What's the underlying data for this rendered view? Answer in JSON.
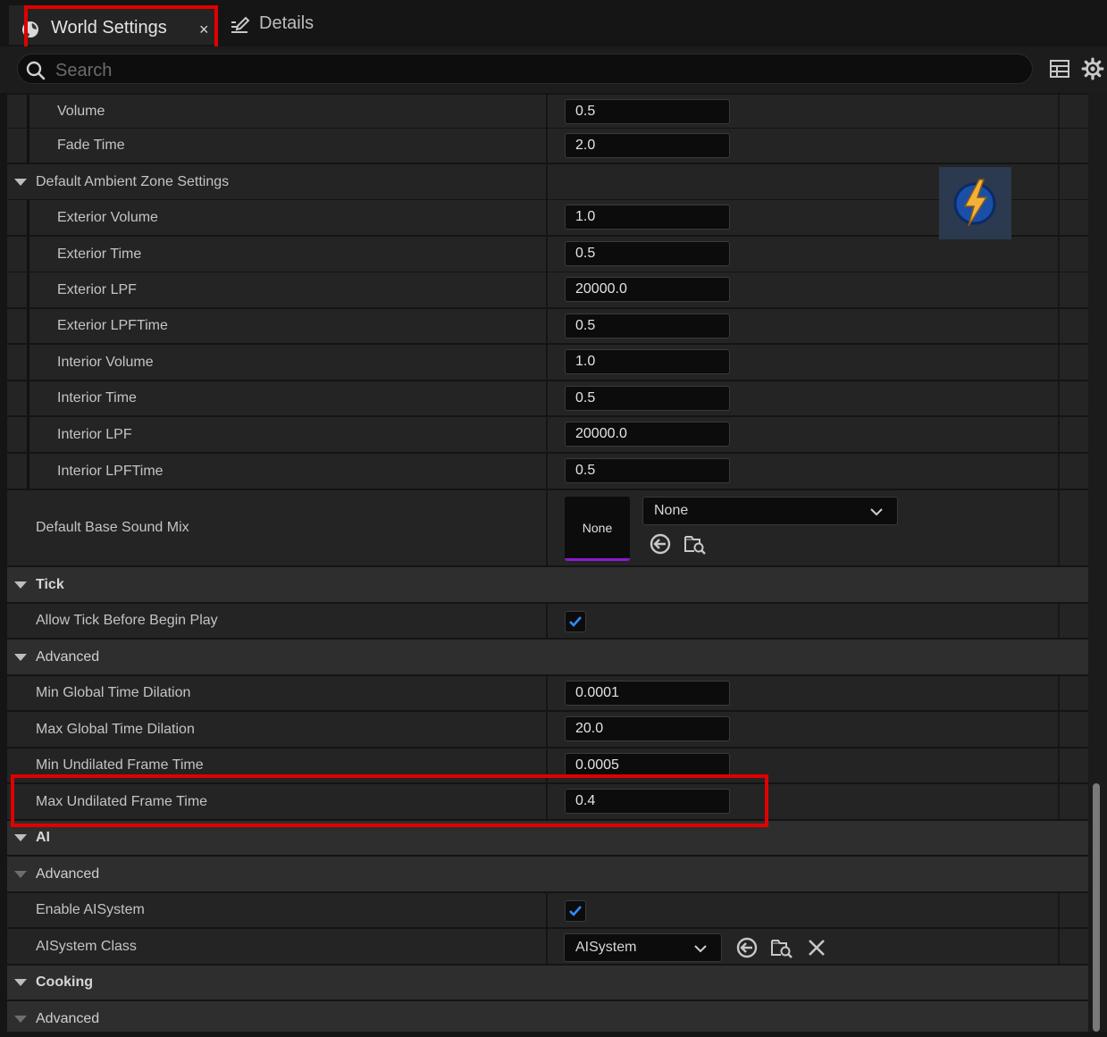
{
  "tabs": {
    "world_settings": "World Settings",
    "close_glyph": "×",
    "details": "Details"
  },
  "search": {
    "placeholder": "Search"
  },
  "rows": {
    "volume": {
      "label": "Volume",
      "value": "0.5"
    },
    "fade_time": {
      "label": "Fade Time",
      "value": "2.0"
    },
    "default_ambient_zone": {
      "label": "Default Ambient Zone Settings"
    },
    "exterior_volume": {
      "label": "Exterior Volume",
      "value": "1.0"
    },
    "exterior_time": {
      "label": "Exterior Time",
      "value": "0.5"
    },
    "exterior_lpf": {
      "label": "Exterior LPF",
      "value": "20000.0"
    },
    "exterior_lpftime": {
      "label": "Exterior LPFTime",
      "value": "0.5"
    },
    "interior_volume": {
      "label": "Interior Volume",
      "value": "1.0"
    },
    "interior_time": {
      "label": "Interior Time",
      "value": "0.5"
    },
    "interior_lpf": {
      "label": "Interior LPF",
      "value": "20000.0"
    },
    "interior_lpftime": {
      "label": "Interior LPFTime",
      "value": "0.5"
    },
    "default_base_sound_mix": {
      "label": "Default Base Sound Mix",
      "thumb": "None",
      "combo": "None"
    },
    "tick": {
      "label": "Tick"
    },
    "allow_tick": {
      "label": "Allow Tick Before Begin Play",
      "checked": true
    },
    "tick_advanced": {
      "label": "Advanced"
    },
    "min_global_time_dilation": {
      "label": "Min Global Time Dilation",
      "value": "0.0001"
    },
    "max_global_time_dilation": {
      "label": "Max Global Time Dilation",
      "value": "20.0"
    },
    "min_undilated_frame_time": {
      "label": "Min Undilated Frame Time",
      "value": "0.0005"
    },
    "max_undilated_frame_time": {
      "label": "Max Undilated Frame Time",
      "value": "0.4"
    },
    "ai": {
      "label": "AI"
    },
    "ai_advanced": {
      "label": "Advanced"
    },
    "enable_aisystem": {
      "label": "Enable AISystem",
      "checked": true
    },
    "aisystem_class": {
      "label": "AISystem Class",
      "value": "AISystem"
    },
    "cooking": {
      "label": "Cooking"
    },
    "cooking_advanced": {
      "label": "Advanced"
    }
  },
  "colors": {
    "highlight": "#e00000",
    "checkmark": "#2f8dff",
    "asset_underline": "#8d18d6"
  }
}
